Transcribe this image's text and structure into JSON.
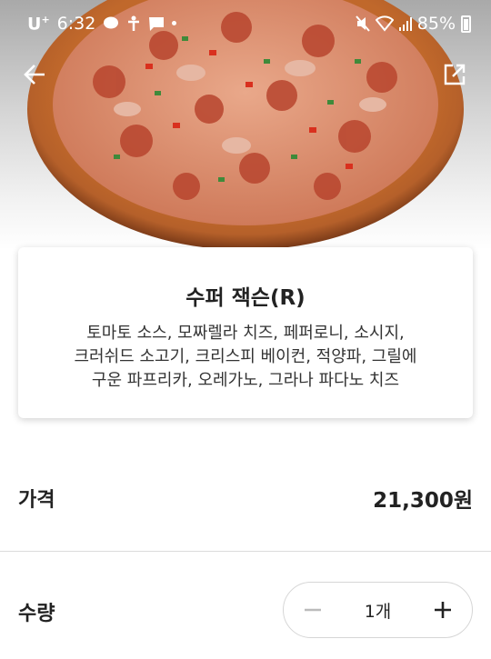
{
  "status_bar": {
    "carrier": "U",
    "carrier_sup": "+",
    "time": "6:32",
    "battery": "85%"
  },
  "nav": {
    "back_icon": "arrow-left-icon",
    "share_icon": "external-share-icon"
  },
  "product": {
    "name": "수퍼 잭슨(R)",
    "description_lines": [
      "토마토 소스, 모짜렐라 치즈, 페퍼로니, 소시지,",
      "크러쉬드 소고기, 크리스피 베이컨, 적양파, 그릴에",
      "구운 파프리카, 오레가노, 그라나 파다노 치즈"
    ]
  },
  "price": {
    "label": "가격",
    "value": "21,300원"
  },
  "quantity": {
    "label": "수량",
    "value": "1개",
    "minus_icon": "minus-icon",
    "plus_icon": "plus-icon"
  },
  "colors": {
    "text": "#222222",
    "divider": "#dcdcdc",
    "minus_disabled": "#bbbbbb"
  }
}
